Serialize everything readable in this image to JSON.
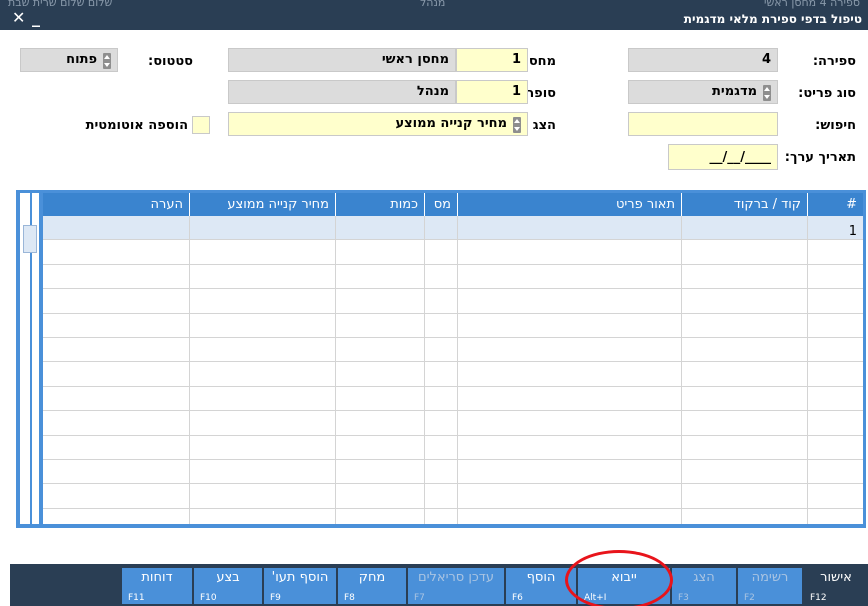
{
  "titlebar": {
    "title": "טיפול בדפי ספירת מלאי מדגמית",
    "faint_left": "שלום שלום שרית שבת",
    "faint_mid": "מנהל",
    "faint_right": "ספירה 4 מחסן ראשי",
    "close_glyph": "✕",
    "minimize_glyph": "_"
  },
  "form": {
    "count_label": "ספירה:",
    "count_value": "4",
    "item_type_label": "סוג פריט:",
    "item_type_value": "מדגמית",
    "search_label": "חיפוש:",
    "search_value": "",
    "date_label": "תאריך ערך:",
    "date_value": "__/__/____",
    "warehouse_label": "מחסן:",
    "warehouse_num": "1",
    "warehouse_name": "מחסן ראשי",
    "counter_label": "סופר:",
    "counter_num": "1",
    "counter_name": "מנהל",
    "price_label": "הצג מחיר:",
    "price_value": "מחיר קנייה ממוצע",
    "status_label": "סטטוס:",
    "status_value": "פתוח",
    "auto_add_label": "הוספה אוטומטית"
  },
  "grid": {
    "columns": [
      "#",
      "קוד / ברקוד",
      "תאור פריט",
      "מס",
      "כמות",
      "מחיר קנייה ממוצע",
      "הערה"
    ],
    "rows": [
      [
        "1",
        "",
        "",
        "",
        "",
        "",
        ""
      ]
    ]
  },
  "toolbar": {
    "buttons": [
      {
        "label": "אישור",
        "key": "F12",
        "enabled": true
      },
      {
        "label": "רשימה",
        "key": "F2",
        "enabled": false
      },
      {
        "label": "הצג",
        "key": "F3",
        "enabled": false
      },
      {
        "label": "ייבוא",
        "key": "Alt+I",
        "enabled": true
      },
      {
        "label": "הוסף",
        "key": "F6",
        "enabled": true
      },
      {
        "label": "עדכן סריאלים",
        "key": "F7",
        "enabled": false
      },
      {
        "label": "מחק",
        "key": "F8",
        "enabled": true
      },
      {
        "label": "הוסף תעו'",
        "key": "F9",
        "enabled": true
      },
      {
        "label": "בצע",
        "key": "F10",
        "enabled": true
      },
      {
        "label": "דוחות",
        "key": "F11",
        "enabled": true
      }
    ]
  },
  "colors": {
    "title_bar": "#2a3e54",
    "grid_header": "#3a84cf",
    "button": "#4a90d9",
    "highlight_circle": "#e8141b",
    "input_yellow": "#ffffcc"
  }
}
